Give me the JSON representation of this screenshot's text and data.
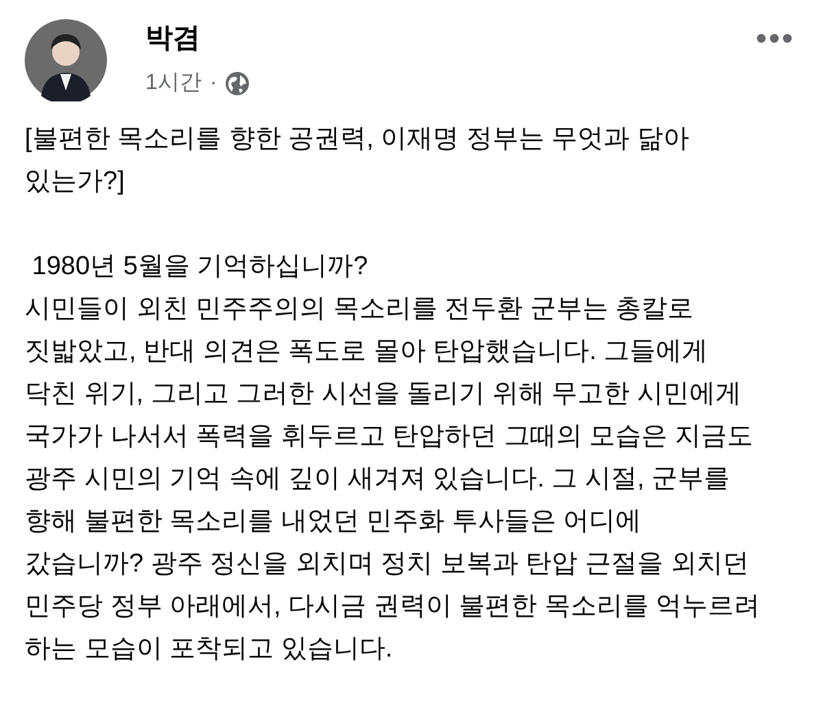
{
  "post": {
    "author": "박겸",
    "time": "1시간",
    "separator": "·",
    "paragraphs": [
      {
        "lines": [
          "[불편한 목소리를 향한 공권력, 이재명 정부는 무엇과 닮아",
          "있는가?]"
        ]
      },
      {
        "lines": [
          " 1980년 5월을 기억하십니까?",
          "시민들이 외친 민주주의의 목소리를 전두환 군부는 총칼로",
          "짓밟았고, 반대 의견은 폭도로 몰아 탄압했습니다. 그들에게",
          "닥친 위기, 그리고 그러한 시선을 돌리기 위해 무고한 시민에게",
          "국가가 나서서 폭력을 휘두르고 탄압하던 그때의 모습은 지금도",
          "광주 시민의 기억 속에 깊이 새겨져 있습니다. 그 시절, 군부를",
          "향해 불편한 목소리를 내었던 민주화 투사들은 어디에",
          "갔습니까? 광주 정신을 외치며 정치 보복과 탄압 근절을 외치던",
          "민주당 정부 아래에서, 다시금 권력이 불편한 목소리를 억누르려",
          "하는 모습이 포착되고 있습니다."
        ]
      }
    ]
  }
}
